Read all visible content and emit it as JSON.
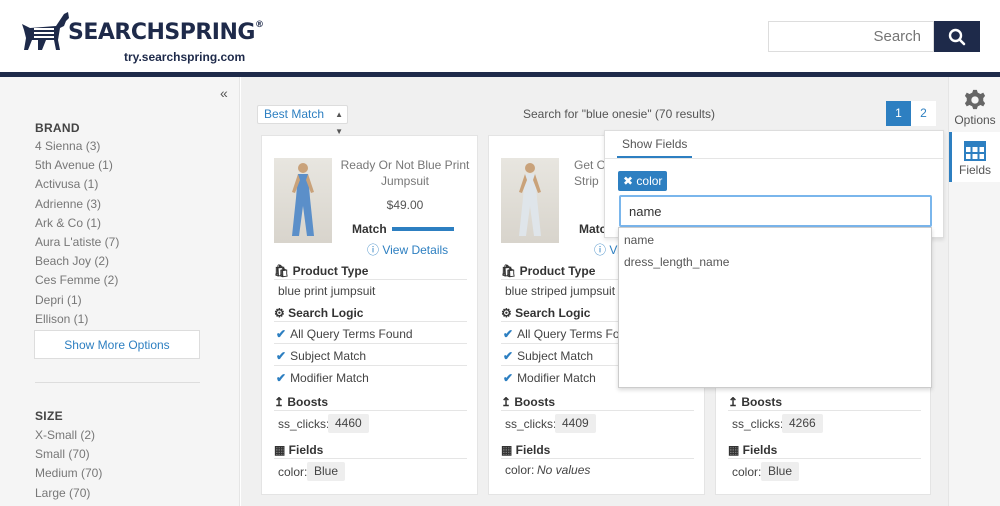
{
  "header": {
    "logo_text": "SEARCHSPRING",
    "logo_reg": "®",
    "logo_url": "try.searchspring.com",
    "search_placeholder": "Search"
  },
  "sidebar": {
    "facets": [
      {
        "title": "BRAND",
        "options": [
          "4 Sienna (3)",
          "5th Avenue (1)",
          "Activusa (1)",
          "Adrienne (3)",
          "Ark & Co (1)",
          "Aura L'atiste (7)",
          "Beach Joy (2)",
          "Ces Femme (2)",
          "Depri (1)",
          "Ellison (1)"
        ],
        "show_more": "Show More Options"
      },
      {
        "title": "SIZE",
        "options": [
          "X-Small (2)",
          "Small (70)",
          "Medium (70)",
          "Large (70)"
        ]
      }
    ]
  },
  "toolbar": {
    "sort": "Best Match",
    "summary": "Search for \"blue onesie\" (70 results)",
    "pages": [
      "1",
      "2"
    ]
  },
  "cards": [
    {
      "name": "Ready Or Not Blue Print Jumpsuit",
      "price": "$49.00",
      "match_label": "Match",
      "match_level": 1.0,
      "view_details": "View Details",
      "product_type_label": "Product Type",
      "product_type": "blue print jumpsuit",
      "search_logic_label": "Search Logic",
      "logic": [
        "All Query Terms Found",
        "Subject Match",
        "Modifier Match"
      ],
      "boosts_label": "Boosts",
      "boost_key": "ss_clicks:",
      "boost_val": "4460",
      "fields_label": "Fields",
      "field_key": "color:",
      "field_val": "Blue"
    },
    {
      "name": "Get Out Of Here Blue Striped Jumpsuit",
      "name_visible": "Get Ou\nStrip",
      "match_label": "Matc",
      "view_details": "Vi",
      "product_type_label": "Product Type",
      "product_type": "blue striped jumpsuit",
      "search_logic_label": "Search Logic",
      "logic": [
        "All Query Terms Fou",
        "Subject Match",
        "Modifier Match"
      ],
      "boosts_label": "Boosts",
      "boost_key": "ss_clicks:",
      "boost_val": "4409",
      "fields_label": "Fields",
      "field_key": "color:",
      "field_none": "No values"
    },
    {
      "boosts_label": "Boosts",
      "boost_key": "ss_clicks:",
      "boost_val": "4266",
      "fields_label": "Fields",
      "field_key": "color:",
      "field_val": "Blue"
    }
  ],
  "fields_panel": {
    "tab": "Show Fields",
    "chip": "color",
    "input_value": "name",
    "suggestions": [
      "name",
      "dress_length_name"
    ]
  },
  "rail": {
    "options_label": "Options",
    "fields_label": "Fields"
  },
  "colors": {
    "accent": "#2d7fc1",
    "navy": "#1e2a4a"
  }
}
